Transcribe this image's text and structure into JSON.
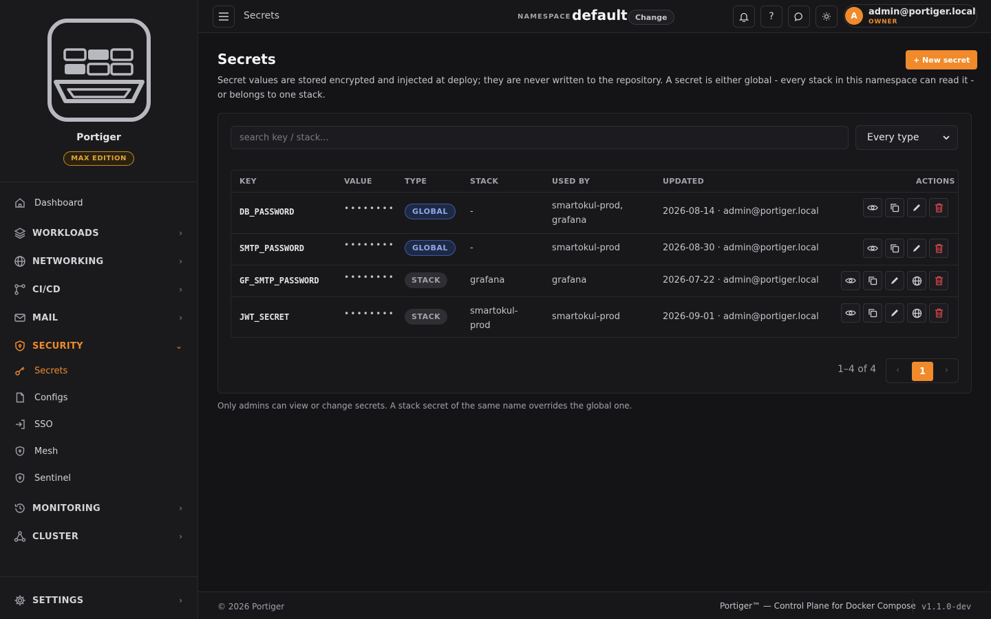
{
  "sidebar": {
    "brand_name": "Portiger",
    "edition": "MAX EDITION",
    "items": [
      {
        "label": "Dashboard"
      },
      {
        "label": "WORKLOADS"
      },
      {
        "label": "NETWORKING"
      },
      {
        "label": "CI/CD"
      },
      {
        "label": "MAIL"
      },
      {
        "label": "SECURITY"
      },
      {
        "label": "Secrets"
      },
      {
        "label": "Configs"
      },
      {
        "label": "SSO"
      },
      {
        "label": "Mesh"
      },
      {
        "label": "Sentinel"
      },
      {
        "label": "MONITORING"
      },
      {
        "label": "CLUSTER"
      },
      {
        "label": "SETTINGS"
      }
    ]
  },
  "topbar": {
    "breadcrumb": "Secrets",
    "namespace_label": "NAMESPACE",
    "namespace_value": "default",
    "change_label": "Change",
    "user_initial": "A",
    "user_name": "admin@portiger.local",
    "user_role": "OWNER"
  },
  "page": {
    "title": "Secrets",
    "new_button": "+ New secret",
    "description": "Secret values are stored encrypted and injected at deploy; they are never written to the repository. A secret is either global - every stack in this namespace can read it - or belongs to one stack.",
    "search_placeholder": "search key / stack...",
    "type_filter": "Every type",
    "columns": [
      "KEY",
      "VALUE",
      "TYPE",
      "STACK",
      "USED BY",
      "UPDATED",
      "ACTIONS"
    ],
    "rows": [
      {
        "key": "DB_PASSWORD",
        "value": "••••••••",
        "type": "GLOBAL",
        "stack": "-",
        "used_by": "smartokul-prod, grafana",
        "updated": "2026-08-14 · admin@portiger.local"
      },
      {
        "key": "SMTP_PASSWORD",
        "value": "••••••••",
        "type": "GLOBAL",
        "stack": "-",
        "used_by": "smartokul-prod",
        "updated": "2026-08-30 · admin@portiger.local"
      },
      {
        "key": "GF_SMTP_PASSWORD",
        "value": "••••••••",
        "type": "STACK",
        "stack": "grafana",
        "used_by": "grafana",
        "updated": "2026-07-22 · admin@portiger.local"
      },
      {
        "key": "JWT_SECRET",
        "value": "••••••••",
        "type": "STACK",
        "stack": "smartokul-prod",
        "used_by": "smartokul-prod",
        "updated": "2026-09-01 · admin@portiger.local"
      }
    ],
    "pager_info": "1–4 of 4",
    "pager_prev": "‹",
    "pager_current": "1",
    "pager_next": "›",
    "footnote": "Only admins can view or change secrets. A stack secret of the same name overrides the global one."
  },
  "footer": {
    "copyright": "© 2026 Portiger",
    "tagline": "Portiger™ — Control Plane for Docker Compose",
    "version": "v1.1.0-dev"
  },
  "colors": {
    "accent": "#f08a2b",
    "danger": "#e5484d",
    "global_badge": "#8fa8e8"
  }
}
